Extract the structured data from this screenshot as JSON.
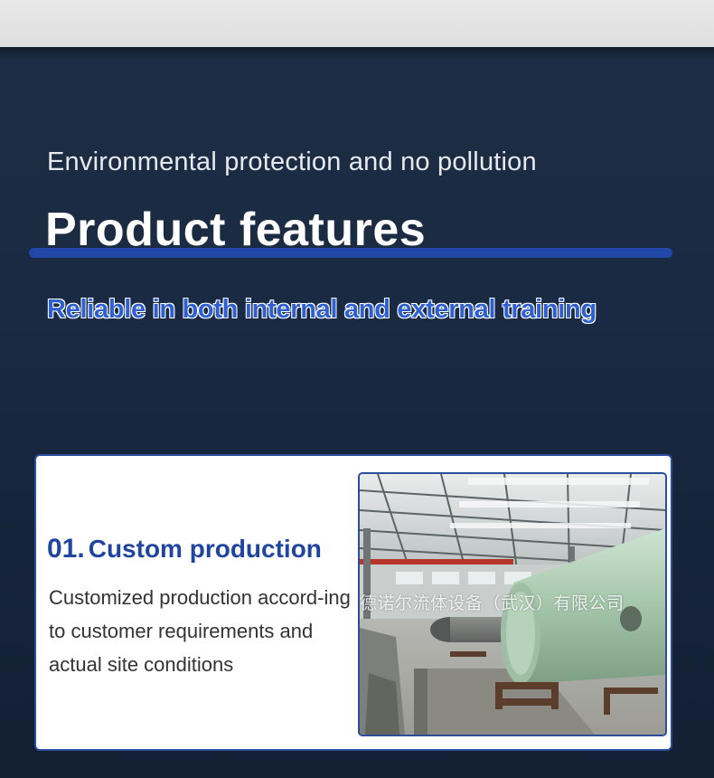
{
  "header": {
    "subtitle": "Environmental protection and no pollution",
    "title": "Product features",
    "tagline": "Reliable in both internal and external training"
  },
  "feature": {
    "number": "01.",
    "name": "Custom production",
    "description": "Customized production accord-ing to customer requirements and actual site conditions",
    "image_watermark": "德诺尔流体设备（武汉）有限公司"
  },
  "colors": {
    "accent_blue": "#2147a8",
    "title_blue": "#1f45a0",
    "background_navy": "#1a2a42"
  }
}
